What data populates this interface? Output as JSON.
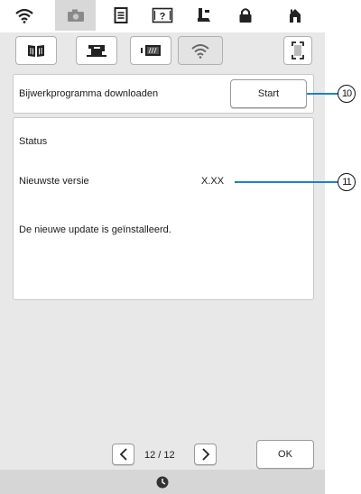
{
  "update": {
    "download_label": "Bijwerkprogramma downloaden",
    "start_button": "Start"
  },
  "status": {
    "heading": "Status",
    "version_label": "Nieuwste versie",
    "version_value": "X.XX",
    "message": "De nieuwe update is geïnstalleerd."
  },
  "pager": {
    "text": "12 / 12"
  },
  "ok_button": "OK",
  "callouts": {
    "c10": "10",
    "c11": "11"
  },
  "icons": {
    "top_tabs": [
      "wifi-icon",
      "camera-icon",
      "document-icon",
      "help-icon",
      "presser-foot-icon",
      "lock-icon",
      "home-icon"
    ],
    "sub_tabs": [
      "book-icon",
      "sewing-machine-icon",
      "display-icon",
      "wifi-icon",
      "screen-capture-icon"
    ],
    "bottom": "clock-icon"
  },
  "colors": {
    "accent_line": "#1f7fd0",
    "active_tab": "#d8d8d8"
  }
}
